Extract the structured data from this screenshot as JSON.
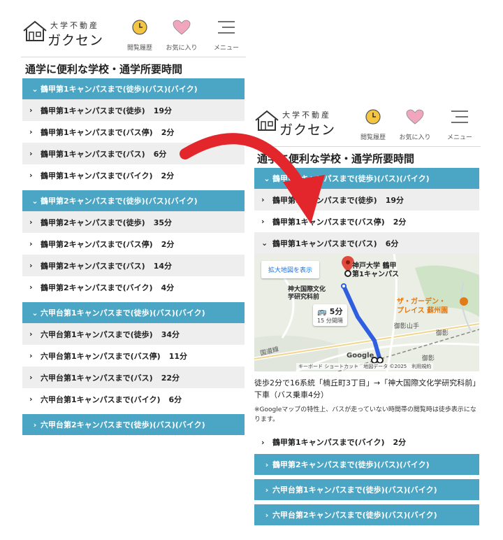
{
  "logo": {
    "sub": "大学不動産",
    "main": "ガクセン"
  },
  "header": {
    "history_label": "閲覧履歴",
    "favorites_label": "お気に入り",
    "menu_label": "メニュー"
  },
  "section_title": "通学に便利な学校・通学所要時間",
  "left": {
    "groups": [
      {
        "label": "鶴甲第1キャンパスまで(徒歩)(バス)(バイク)",
        "items": [
          {
            "label": "鶴甲第1キャンパスまで(徒歩)",
            "time": "19分"
          },
          {
            "label": "鶴甲第1キャンパスまで(バス停)",
            "time": "2分"
          },
          {
            "label": "鶴甲第1キャンパスまで(バス)",
            "time": "6分"
          },
          {
            "label": "鶴甲第1キャンパスまで(バイク)",
            "time": "2分"
          }
        ]
      },
      {
        "label": "鶴甲第2キャンパスまで(徒歩)(バス)(バイク)",
        "items": [
          {
            "label": "鶴甲第2キャンパスまで(徒歩)",
            "time": "35分"
          },
          {
            "label": "鶴甲第2キャンパスまで(バス停)",
            "time": "2分"
          },
          {
            "label": "鶴甲第2キャンパスまで(バス)",
            "time": "14分"
          },
          {
            "label": "鶴甲第2キャンパスまで(バイク)",
            "time": "4分"
          }
        ]
      },
      {
        "label": "六甲台第1キャンパスまで(徒歩)(バス)(バイク)",
        "items": [
          {
            "label": "六甲台第1キャンパスまで(徒歩)",
            "time": "34分"
          },
          {
            "label": "六甲台第1キャンパスまで(バス停)",
            "time": "11分"
          },
          {
            "label": "六甲台第1キャンパスまで(バス)",
            "time": "22分"
          },
          {
            "label": "六甲台第1キャンパスまで(バイク)",
            "time": "6分"
          }
        ]
      },
      {
        "label": "六甲台第2キャンパスまで(徒歩)(バス)(バイク)"
      }
    ]
  },
  "right": {
    "group": "鶴甲第1キャンパスまで(徒歩)(バス)(バイク)",
    "items": [
      {
        "label": "鶴甲第1キャンパスまで(徒歩)",
        "time": "19分"
      },
      {
        "label": "鶴甲第1キャンパスまで(バス停)",
        "time": "2分"
      },
      {
        "label": "鶴甲第1キャンパスまで(バス)",
        "time": "6分"
      }
    ],
    "map": {
      "expand_button": "拡大地図を表示",
      "destination_line1": "神戸大学 鶴甲",
      "destination_line2": "第1キャンパス",
      "stop_line1": "神大国際文化",
      "stop_line2": "学研究科前",
      "bus_time": "5分",
      "bus_interval": "15 分間隔",
      "garden_line1": "ザ・ガーデン・",
      "garden_line2": "プレイス 蘇州園",
      "label_mikage_yamate": "御影山手",
      "label_mikage": "御影",
      "label_mikage2": "御影",
      "label_kokudo": "国道線",
      "google": "Google",
      "footer": "キーボード ショートカット　地図データ ©2025　利用規約"
    },
    "route_description": "徒歩2分で16系統「楠丘町3丁目」→「神大国際文化学研究科前」下車（バス乗車4分）",
    "route_note": "※Googleマップの特性上、バスが走っていない時間帯の閲覧時は徒歩表示になります。",
    "after_item": {
      "label": "鶴甲第1キャンパスまで(バイク)",
      "time": "2分"
    },
    "collapsed_groups": [
      "鶴甲第2キャンパスまで(徒歩)(バス)(バイク)",
      "六甲台第1キャンパスまで(徒歩)(バス)(バイク)",
      "六甲台第2キャンパスまで(徒歩)(バス)(バイク)"
    ]
  },
  "colors": {
    "accent": "#4aa6c4",
    "arrow": "#e3262c",
    "route": "#2f5fe0",
    "pin": "#e04a3c",
    "clock": "#f4c542",
    "heart": "#f2a6bd"
  },
  "icons": {
    "history": "clock-icon",
    "favorites": "heart-icon",
    "menu": "hamburger-icon"
  }
}
